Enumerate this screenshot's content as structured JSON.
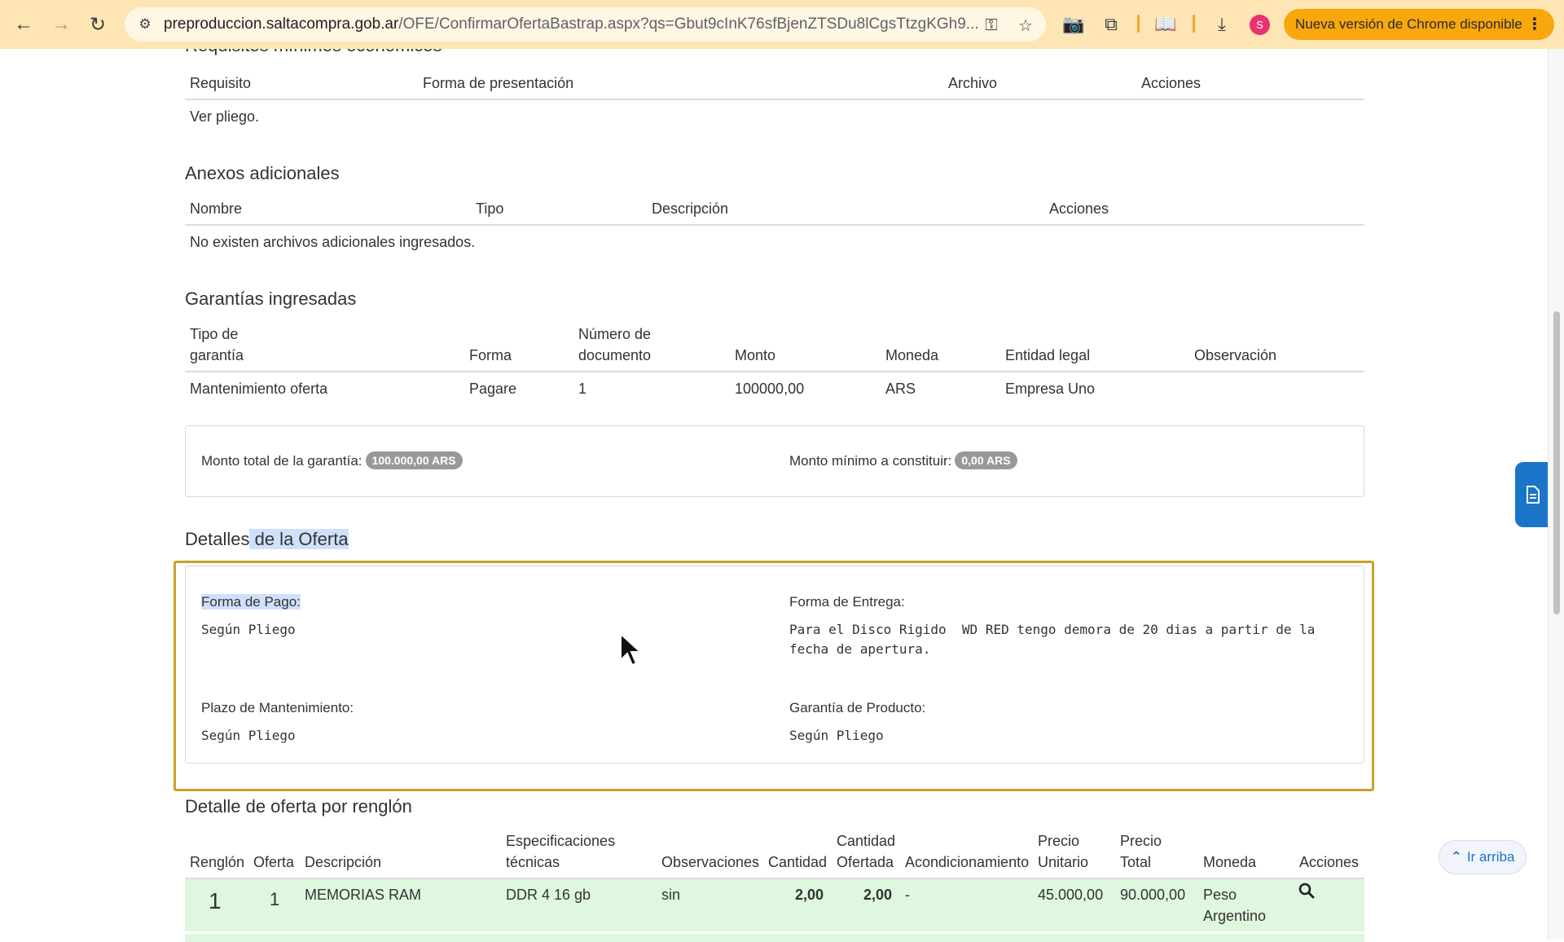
{
  "browser": {
    "url_host": "preproduccion.saltacompra.gob.ar",
    "url_path": "/OFE/ConfirmarOfertaBastrap.aspx?qs=Gbut9cInK76sfBjenZTSDu8lCgsTtzgKGh9...",
    "update_label": "Nueva versión de Chrome disponible",
    "profile_initial": "S",
    "icons": [
      "back-icon",
      "forward-icon",
      "reload-icon",
      "site-settings-icon",
      "key-icon",
      "star-icon",
      "camera-icon",
      "extensions-icon",
      "reading-list-icon",
      "download-icon",
      "more-icon"
    ]
  },
  "requisitos": {
    "title": "Requisitos mínimos económicos",
    "headers": [
      "Requisito",
      "Forma de presentación",
      "Archivo",
      "Acciones"
    ],
    "empty": "Ver pliego."
  },
  "anexos": {
    "title": "Anexos adicionales",
    "headers": [
      "Nombre",
      "Tipo",
      "Descripción",
      "Acciones"
    ],
    "empty": "No existen archivos adicionales ingresados."
  },
  "garantias": {
    "title": "Garantías ingresadas",
    "headers": {
      "tipo_1": "Tipo de",
      "tipo_2": "garantía",
      "forma": "Forma",
      "numero_1": "Número de",
      "numero_2": "documento",
      "monto": "Monto",
      "moneda": "Moneda",
      "entidad": "Entidad legal",
      "observacion": "Observación"
    },
    "row": {
      "tipo": "Mantenimiento oferta",
      "forma": "Pagare",
      "numero": "1",
      "monto": "100000,00",
      "moneda": "ARS",
      "entidad": "Empresa Uno",
      "observacion": ""
    },
    "total_label": "Monto total de la garantía:",
    "total_value": "100.000,00 ARS",
    "minimo_label": "Monto mínimo a constituir:",
    "minimo_value": "0,00 ARS"
  },
  "detalles": {
    "title_plain": "Detalles",
    "title_highlight": " de la Oferta",
    "forma_pago_label": "Forma de Pago:",
    "forma_pago_value": "Según Pliego",
    "forma_entrega_label": "Forma de Entrega:",
    "forma_entrega_line1": "Para el Disco Rigido  WD RED tengo demora de 20 dias a partir de la",
    "forma_entrega_line2": "fecha de apertura.",
    "plazo_label": "Plazo de Mantenimiento:",
    "plazo_value": "Según Pliego",
    "garantia_label": "Garantía de Producto:",
    "garantia_value": "Según Pliego"
  },
  "renglones": {
    "title": "Detalle de oferta por renglón",
    "headers": {
      "renglon": "Renglón",
      "oferta": "Oferta",
      "descripcion": "Descripción",
      "espec_1": "Especificaciones",
      "espec_2": "técnicas",
      "observaciones": "Observaciones",
      "cantidad": "Cantidad",
      "cant_of_1": "Cantidad",
      "cant_of_2": "Ofertada",
      "acondicionamiento": "Acondicionamiento",
      "pu_1": "Precio",
      "pu_2": "Unitario",
      "pt_1": "Precio",
      "pt_2": "Total",
      "moneda": "Moneda",
      "acciones": "Acciones"
    },
    "row": {
      "renglon": "1",
      "oferta": "1",
      "descripcion": "MEMORIAS RAM",
      "especificaciones": "DDR 4 16 gb",
      "observaciones": "sin",
      "cantidad": "2,00",
      "cantidad_ofertada": "2,00",
      "acondicionamiento": "-",
      "precio_unitario": "45.000,00",
      "precio_total": "90.000,00",
      "moneda_1": "Peso",
      "moneda_2": "Argentino"
    }
  },
  "ir_arriba": "Ir arriba"
}
